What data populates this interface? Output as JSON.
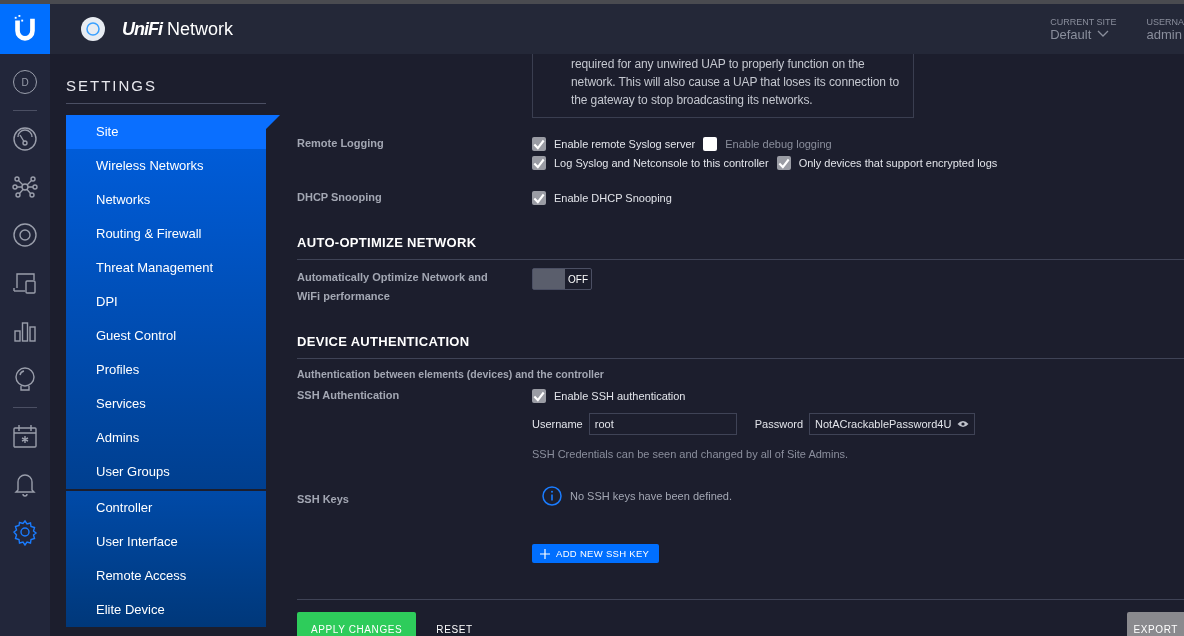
{
  "rail": {
    "groups": [
      [
        {
          "kind": "site",
          "label": "D",
          "selected": false
        }
      ],
      [
        {
          "kind": "gauge",
          "selected": false
        },
        {
          "kind": "topology",
          "selected": false
        },
        {
          "kind": "device",
          "selected": false
        },
        {
          "kind": "clients",
          "selected": false
        },
        {
          "kind": "stats",
          "selected": false
        },
        {
          "kind": "bulb",
          "selected": false
        }
      ],
      [
        {
          "kind": "calendar",
          "selected": false
        },
        {
          "kind": "bell",
          "selected": false
        },
        {
          "kind": "gear",
          "selected": true
        }
      ]
    ]
  },
  "header": {
    "logo_text": "UniFi",
    "app_name": "Network",
    "current_site": {
      "label": "CURRENT SITE",
      "value": "Default"
    },
    "username": {
      "label": "USERNA",
      "value": "admin"
    }
  },
  "settings": {
    "title": "SETTINGS",
    "groups": [
      [
        {
          "label": "Site",
          "selected": true
        },
        {
          "label": "Wireless Networks",
          "selected": false
        },
        {
          "label": "Networks",
          "selected": false
        },
        {
          "label": "Routing & Firewall",
          "selected": false
        },
        {
          "label": "Threat Management",
          "selected": false
        },
        {
          "label": "DPI",
          "selected": false
        },
        {
          "label": "Guest Control",
          "selected": false
        },
        {
          "label": "Profiles",
          "selected": false
        },
        {
          "label": "Services",
          "selected": false
        },
        {
          "label": "Admins",
          "selected": false
        },
        {
          "label": "User Groups",
          "selected": false
        }
      ],
      [
        {
          "label": "Controller",
          "selected": false
        },
        {
          "label": "User Interface",
          "selected": false
        },
        {
          "label": "Remote Access",
          "selected": false
        },
        {
          "label": "Elite Device",
          "selected": false
        }
      ]
    ]
  },
  "notice": "required for any unwired UAP to properly function on the network. This will also cause a UAP that loses its connection to the gateway to stop broadcasting its networks.",
  "sections": [
    {
      "rows": [
        {
          "kind": "checkboxes",
          "label": "Remote Logging",
          "lines": [
            [
              {
                "label": "Enable remote Syslog server",
                "checked": true
              },
              {
                "label": "Enable debug logging",
                "checked": false
              }
            ],
            [
              {
                "label": "Log Syslog and Netconsole to this controller",
                "checked": true
              },
              {
                "label": "Only devices that support encrypted logs",
                "checked": true
              }
            ]
          ]
        },
        {
          "kind": "checkboxes",
          "label": "DHCP Snooping",
          "lines": [
            [
              {
                "label": "Enable DHCP Snooping",
                "checked": true
              }
            ]
          ]
        }
      ]
    },
    {
      "title": "AUTO-OPTIMIZE NETWORK",
      "rows": [
        {
          "kind": "toggle",
          "label": "Automatically Optimize Network and WiFi performance",
          "on": false,
          "state_text": "OFF"
        }
      ]
    },
    {
      "title": "DEVICE AUTHENTICATION",
      "description": "Authentication between elements (devices) and the controller",
      "rows": [
        {
          "kind": "checkboxes",
          "label": "SSH Authentication",
          "lines": [
            [
              {
                "label": "Enable SSH authentication",
                "checked": true
              }
            ]
          ]
        },
        {
          "kind": "credentials",
          "fields": [
            {
              "kind": "text",
              "label": "Username",
              "value": "root"
            },
            {
              "kind": "password",
              "label": "Password",
              "value": "NotACrackablePassword4U"
            }
          ],
          "note": "SSH Credentials can be seen and changed by all of Site Admins."
        },
        {
          "kind": "keys",
          "label": "SSH Keys",
          "message": "No SSH keys have been defined.",
          "button": "ADD NEW SSH KEY"
        }
      ]
    }
  ],
  "footer": {
    "buttons": [
      {
        "kind": "primary",
        "label": "APPLY CHANGES"
      },
      {
        "kind": "plain",
        "label": "RESET"
      },
      {
        "kind": "secondary",
        "label": "EXPORT"
      }
    ]
  }
}
